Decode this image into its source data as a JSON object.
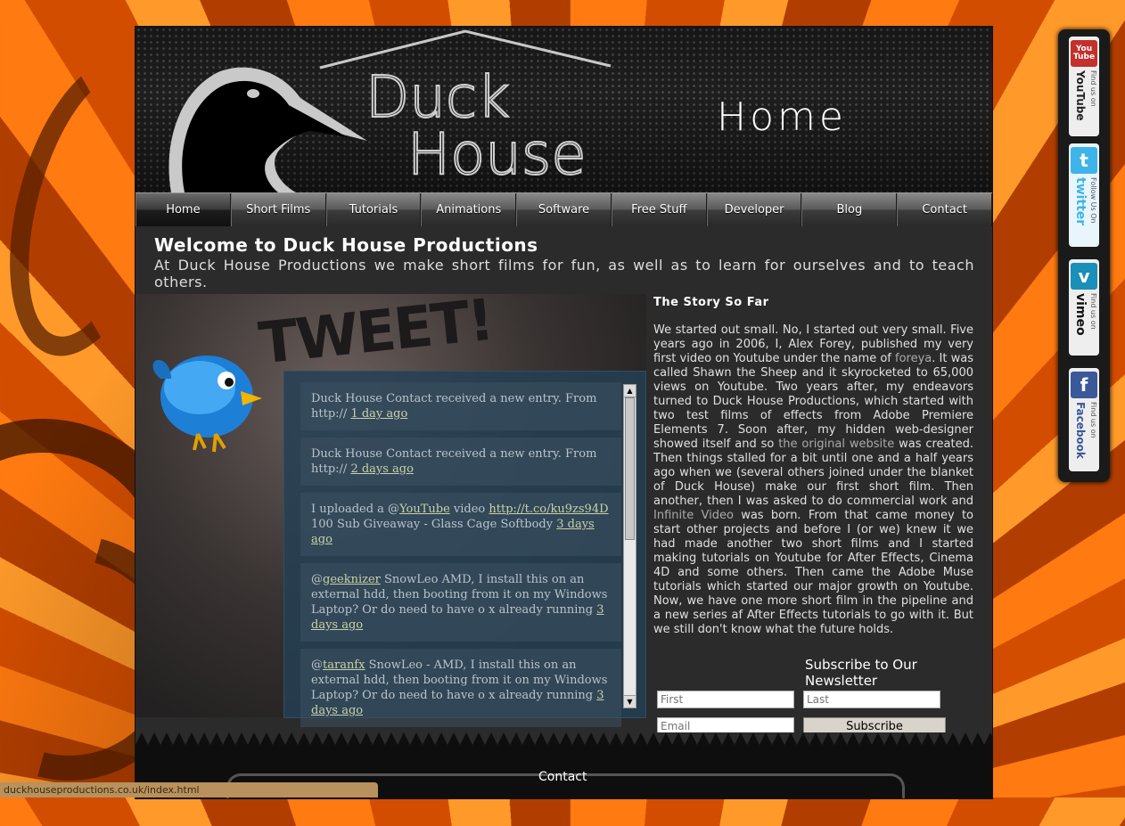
{
  "brand": {
    "line1": "Duck",
    "line2": "House"
  },
  "page_heading": "Home",
  "nav": {
    "items": [
      {
        "label": "Home",
        "active": true
      },
      {
        "label": "Short Films"
      },
      {
        "label": "Tutorials"
      },
      {
        "label": "Animations"
      },
      {
        "label": "Software"
      },
      {
        "label": "Free Stuff"
      },
      {
        "label": "Developer"
      },
      {
        "label": "Blog"
      },
      {
        "label": "Contact"
      }
    ]
  },
  "welcome": {
    "title": "Welcome to Duck House Productions",
    "text": "At Duck House Productions we make short films for fun, as well as to learn for ourselves and to teach others."
  },
  "tweet_panel": {
    "heading": "TWEET!",
    "tweets": [
      {
        "text": "Duck House Contact received a new entry. From http://",
        "time": "1 day ago"
      },
      {
        "text": "Duck House Contact received a new entry. From http://",
        "time": "2 days ago"
      },
      {
        "prefix": "I uploaded a @",
        "mention": "YouTube",
        "middle": " video ",
        "link": "http://t.co/ku9zs94D",
        "text": "100 Sub Giveaway - Glass Cage Softbody",
        "time": "3 days ago"
      },
      {
        "prefix": "@",
        "mention": "geeknizer",
        "text": "SnowLeo AMD, I install this on an external hdd, then booting from it on my Windows Laptop? Or do need to have o x already running",
        "time": "3 days ago"
      },
      {
        "prefix": "@",
        "mention": "taranfx",
        "text": "SnowLeo - AMD, I install this on an external hdd, then booting from it on my Windows Laptop? Or do need to have o x already running",
        "time": "3 days ago"
      }
    ]
  },
  "story": {
    "title": "The Story So Far",
    "p1": "We started out small. No, I started out very small. Five years ago in 2006, I, Alex Forey, published my very first video on Youtube under the name of ",
    "link1": "foreya",
    "p2": ". It was called Shawn the Sheep and it skyrocketed to 65,000 views on Youtube. Two years after, my endeavors turned to Duck House Productions, which started with two test films of effects from Adobe Premiere Elements 7. Soon after, my hidden web-designer showed itself and so ",
    "link2": "the original website",
    "p3": " was created. Then things stalled for a bit until one and a half years ago when we (several others joined under the blanket of Duck House) make our first short film. Then another, then I was asked to do commercial work and ",
    "link3": "Infinite Video",
    "p4": " was born. From that came money to start other projects and before I (or we) knew it we had made another two short films and I started making tutorials on Youtube for After Effects, Cinema 4D and some others. Then came the Adobe Muse tutorials which started our major growth on Youtube. Now, we have one more short film in the pipeline and a new series af After Effects tutorials to go with it. But we still don't know what the future holds."
  },
  "newsletter": {
    "title": "Subscribe to Our Newsletter",
    "first_placeholder": "First",
    "last_placeholder": "Last",
    "email_placeholder": "Email",
    "submit_label": "Subscribe"
  },
  "footer": {
    "contact_label": "Contact"
  },
  "status_bar": {
    "url": "duckhouseproductions.co.uk/index.html"
  },
  "social": {
    "youtube": {
      "small": "Find us on",
      "big": "YouTube",
      "icon": "You Tube",
      "color": "#c4302b"
    },
    "twitter": {
      "small": "Follow Us On",
      "big": "twitter",
      "icon": "t",
      "color": "#3fb4e8"
    },
    "vimeo": {
      "small": "Find us on",
      "big": "vimeo",
      "icon": "v",
      "color": "#1a8fb8"
    },
    "facebook": {
      "small": "Find us on",
      "big": "Facebook",
      "icon": "f",
      "color": "#3b5998"
    }
  }
}
